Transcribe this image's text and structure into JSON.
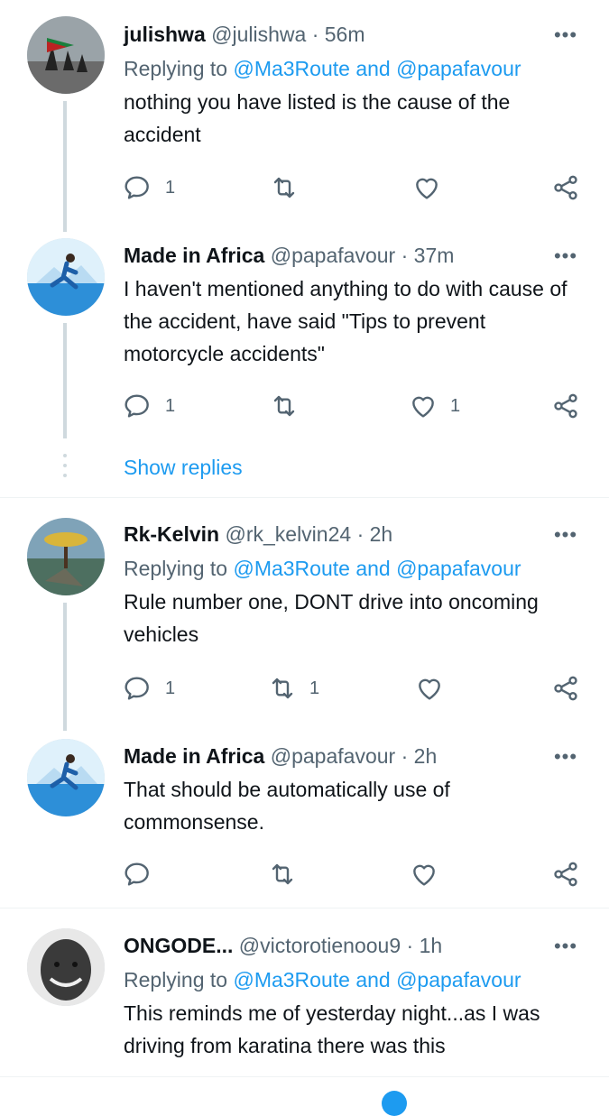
{
  "colors": {
    "accent": "#1d9bf0",
    "secondary_text": "#536471",
    "primary_text": "#0f1419",
    "thread_line": "#cfd9de"
  },
  "tweets": [
    {
      "name": "julishwa",
      "handle": "@julishwa",
      "sep": "·",
      "time": "56m",
      "replying_prefix": "Replying to",
      "replying_mentions": "@Ma3Route and @papafavour",
      "text": "nothing you have listed is the cause of the accident",
      "reply_count": "1",
      "retweet_count": "",
      "like_count": "",
      "more": "•••"
    },
    {
      "name": "Made in Africa",
      "handle": "@papafavour",
      "sep": "·",
      "time": "37m",
      "text": "I haven't mentioned anything to do with cause of the accident, have said \"Tips to prevent motorcycle accidents\"",
      "reply_count": "1",
      "retweet_count": "",
      "like_count": "1",
      "more": "•••"
    },
    {
      "name": "Rk-Kelvin",
      "handle": "@rk_kelvin24",
      "sep": "·",
      "time": "2h",
      "replying_prefix": "Replying to",
      "replying_mentions": "@Ma3Route and @papafavour",
      "text": "Rule number one, DONT drive into oncoming vehicles",
      "reply_count": "1",
      "retweet_count": "1",
      "like_count": "",
      "more": "•••"
    },
    {
      "name": "Made in Africa",
      "handle": "@papafavour",
      "sep": "·",
      "time": "2h",
      "text": "That should be automatically use of commonsense.",
      "reply_count": "",
      "retweet_count": "",
      "like_count": "",
      "more": "•••"
    },
    {
      "name": "ONGODE...",
      "handle": "@victorotienoou9",
      "sep": "·",
      "time": "1h",
      "replying_prefix": "Replying to",
      "replying_mentions": "@Ma3Route and @papafavour",
      "text": "This reminds me of yesterday night...as I was driving from karatina there was this",
      "more": "•••"
    }
  ],
  "show_replies": "Show replies",
  "icons": [
    "reply-icon",
    "retweet-icon",
    "like-icon",
    "share-icon",
    "more-icon"
  ]
}
